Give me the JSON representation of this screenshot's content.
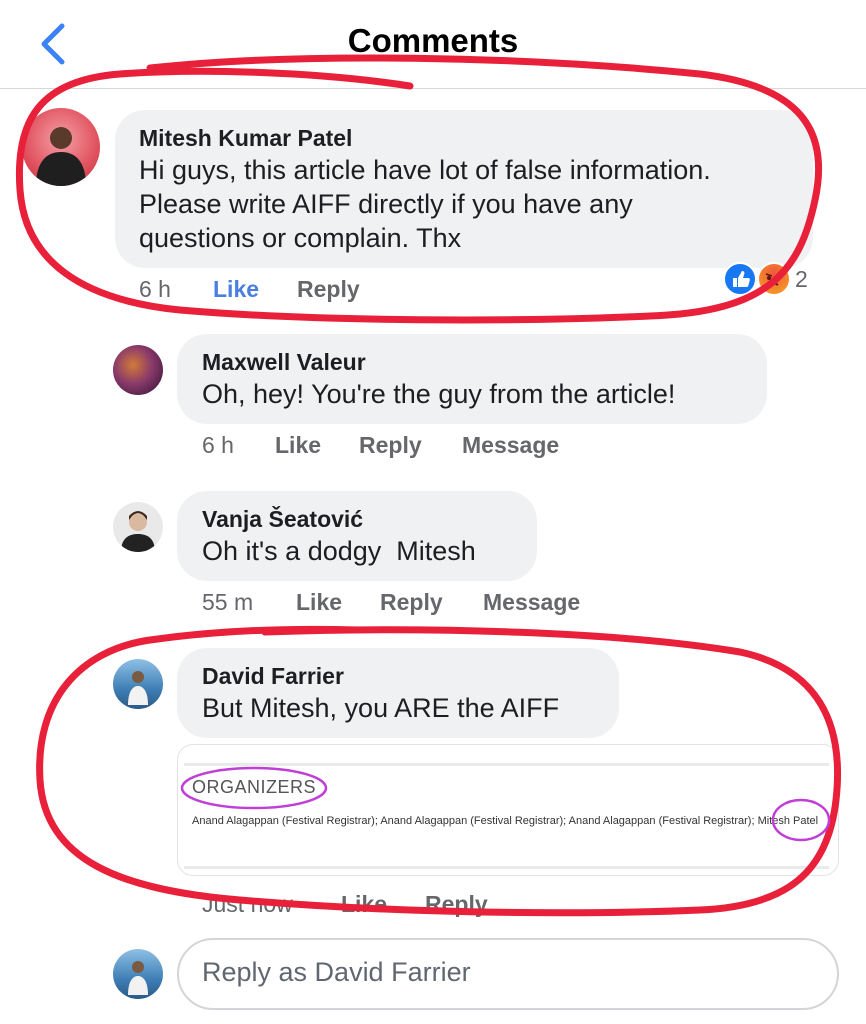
{
  "header": {
    "title": "Comments"
  },
  "comments": [
    {
      "author": "Mitesh Kumar Patel",
      "lines": [
        "Hi guys, this article have lot of false information.",
        "Please write AIFF directly if you have any",
        "questions or complain. Thx"
      ],
      "time": "6 h",
      "like": "Like",
      "reply": "Reply",
      "reaction_count": "2",
      "reactions": [
        "like-icon",
        "angry-icon"
      ]
    },
    {
      "author": "Maxwell Valeur",
      "text": "Oh, hey! You're the guy from the article!",
      "time": "6 h",
      "like": "Like",
      "reply": "Reply",
      "message": "Message"
    },
    {
      "author": "Vanja Šeatović",
      "text": "Oh it's a dodgy  Mitesh",
      "time": "55 m",
      "like": "Like",
      "reply": "Reply",
      "message": "Message"
    },
    {
      "author": "David Farrier",
      "text": "But Mitesh, you ARE the AIFF",
      "time": "Just now",
      "like": "Like",
      "reply": "Reply",
      "attachment": {
        "heading": "ORGANIZERS",
        "body": "Anand Alagappan (Festival Registrar); Anand Alagappan (Festival Registrar); Anand Alagappan (Festival Registrar); Mitesh Patel"
      }
    }
  ],
  "composer": {
    "placeholder": "Reply as David Farrier"
  },
  "colors": {
    "annotation_red": "#e8203a",
    "annotation_purple": "#c03fd6",
    "like_blue": "#1877f2",
    "back_blue": "#3b82f6"
  }
}
